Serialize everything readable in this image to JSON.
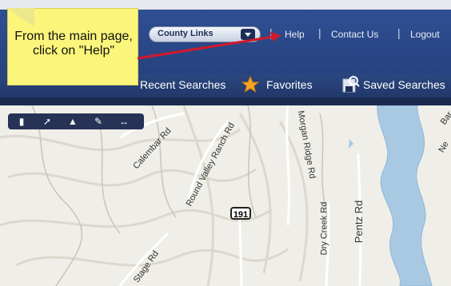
{
  "header": {
    "county_links_label": "County Links",
    "links": [
      {
        "label": "Help"
      },
      {
        "label": "Contact Us"
      },
      {
        "label": "Logout"
      }
    ],
    "separator": "|"
  },
  "tabs": [
    {
      "label": "Recent Searches"
    },
    {
      "label": "Favorites"
    },
    {
      "label": "Saved Searches"
    }
  ],
  "callout": {
    "text": "From the main page, click on \"Help\""
  },
  "map": {
    "toolbar": [
      {
        "icon": "comment-icon"
      },
      {
        "icon": "pin-icon"
      },
      {
        "icon": "trash-icon"
      },
      {
        "icon": "pencil-icon"
      },
      {
        "icon": "measure-icon"
      }
    ],
    "roads": [
      {
        "label": "Calembar Rd"
      },
      {
        "label": "Round Valley Ranch Rd"
      },
      {
        "label": "Morgan Ridge Rd"
      },
      {
        "label": "Dry Creek Rd"
      },
      {
        "label": "Pentz Rd"
      },
      {
        "label": "Stage Rd"
      },
      {
        "label": "Ne"
      },
      {
        "label": "Bar"
      }
    ],
    "shield": "191"
  },
  "colors": {
    "navbar": "#2f4f93",
    "note": "#fbf57b",
    "arrow": "#d1192b",
    "water": "#a9c9e2",
    "land": "#efeee8"
  }
}
